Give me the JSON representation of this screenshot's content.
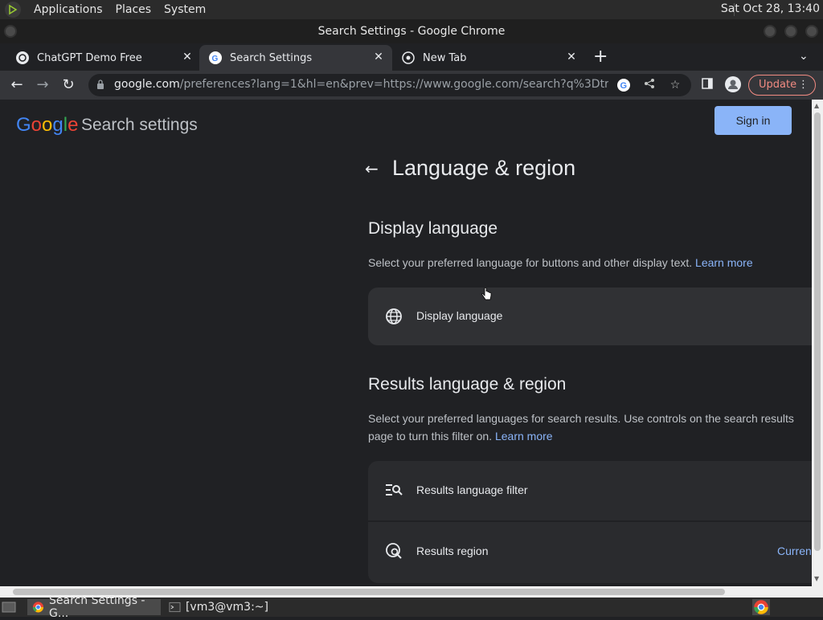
{
  "os_panel": {
    "menus": [
      "Applications",
      "Places",
      "System"
    ],
    "clock": "Sat Oct 28, 13:40"
  },
  "window": {
    "title": "Search Settings - Google Chrome"
  },
  "tabs": [
    {
      "label": "ChatGPT Demo Free",
      "active": false
    },
    {
      "label": "Search Settings",
      "active": true
    },
    {
      "label": "New Tab",
      "active": false
    }
  ],
  "toolbar": {
    "url_host": "google.com",
    "url_path": "/preferences?lang=1&hl=en&prev=https://www.google.com/search?q%3Dtransform...",
    "update_label": "Update"
  },
  "page": {
    "logo_text": [
      "G",
      "o",
      "o",
      "g",
      "l",
      "e"
    ],
    "header_sub": "Search settings",
    "signin_label": "Sign in",
    "title": "Language & region",
    "display_language": {
      "heading": "Display language",
      "description": "Select your preferred language for buttons and other display text.",
      "learn_more": "Learn more",
      "card_label": "Display language"
    },
    "results": {
      "heading": "Results language & region",
      "description": "Select your preferred languages for search results. Use controls on the search results page to turn this filter on.",
      "learn_more": "Learn more",
      "filter_label": "Results language filter",
      "region_label": "Results region",
      "region_value": "Current"
    }
  },
  "taskbar": {
    "items": [
      "Search Settings - G...",
      "[vm3@vm3:~]"
    ]
  },
  "colors": {
    "accent": "#8ab4f8",
    "background": "#202124",
    "card": "#303134"
  }
}
